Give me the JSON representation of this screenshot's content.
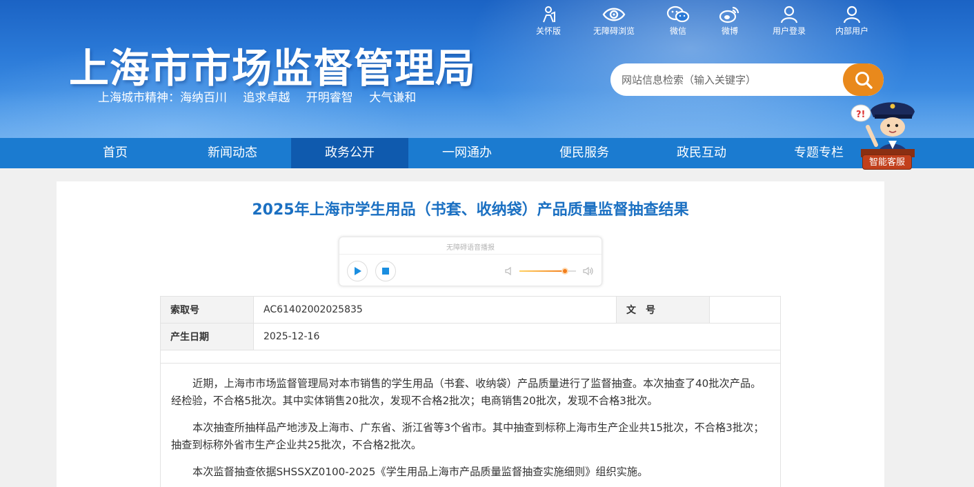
{
  "header": {
    "site_title": "上海市市场监督管理局",
    "slogan": "上海城市精神：海纳百川  追求卓越  开明睿智  大气谦和",
    "top_links": [
      {
        "label": "关怀版",
        "icon": "elderly-care-icon"
      },
      {
        "label": "无障碍浏览",
        "icon": "eye-icon"
      },
      {
        "label": "微信",
        "icon": "wechat-icon"
      },
      {
        "label": "微博",
        "icon": "weibo-icon"
      },
      {
        "label": "用户登录",
        "icon": "user-icon"
      },
      {
        "label": "内部用户",
        "icon": "user-icon"
      }
    ],
    "search": {
      "placeholder": "网站信息检索（输入关键字）",
      "icon": "search-icon"
    }
  },
  "nav": {
    "items": [
      {
        "label": "首页"
      },
      {
        "label": "新闻动态"
      },
      {
        "label": "政务公开"
      },
      {
        "label": "一网通办"
      },
      {
        "label": "便民服务"
      },
      {
        "label": "政民互动"
      },
      {
        "label": "专题专栏"
      }
    ],
    "active_index": 2
  },
  "assistant": {
    "label": "智能客服"
  },
  "article": {
    "title": "2025年上海市学生用品（书套、收纳袋）产品质量监督抽查结果",
    "player": {
      "label": "无障碍语音播报",
      "volume": 0.8
    },
    "meta": {
      "index_label": "索取号",
      "index_value": "AC61402002025835",
      "doc_label": "文　号",
      "doc_value": "",
      "date_label": "产生日期",
      "date_value": "2025-12-16"
    },
    "paragraphs": [
      "近期，上海市市场监督管理局对本市销售的学生用品（书套、收纳袋）产品质量进行了监督抽查。本次抽查了40批次产品。经检验，不合格5批次。其中实体销售20批次，发现不合格2批次；电商销售20批次，发现不合格3批次。",
      "本次抽查所抽样品产地涉及上海市、广东省、浙江省等3个省市。其中抽查到标称上海市生产企业共15批次，不合格3批次；抽查到标称外省市生产企业共25批次，不合格2批次。",
      "本次监督抽查依据SHSSXZ0100-2025《学生用品上海市产品质量监督抽查实施细则》组织实施。"
    ]
  },
  "colors": {
    "header_blue": "#2b7ad8",
    "nav_blue": "#1b7bd0",
    "nav_active": "#0f5aae",
    "title_blue": "#1b70c2",
    "search_orange": "#e9891c"
  }
}
